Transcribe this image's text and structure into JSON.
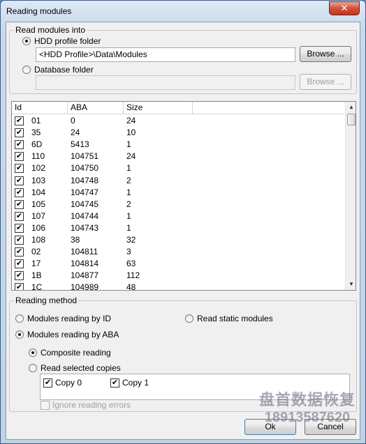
{
  "window": {
    "title": "Reading modules",
    "close_glyph": "✕"
  },
  "read_into": {
    "group_title": "Read modules into",
    "hdd_radio_label": "HDD profile folder",
    "hdd_path": "<HDD Profile>\\Data\\Modules",
    "hdd_browse": "Browse ...",
    "db_radio_label": "Database folder",
    "db_path": "",
    "db_browse": "Browse ..."
  },
  "modules_table": {
    "columns": [
      "Id",
      "ABA",
      "Size"
    ],
    "rows": [
      {
        "checked": true,
        "id": "01",
        "aba": "0",
        "size": "24"
      },
      {
        "checked": true,
        "id": "35",
        "aba": "24",
        "size": "10"
      },
      {
        "checked": true,
        "id": "6D",
        "aba": "5413",
        "size": "1"
      },
      {
        "checked": true,
        "id": "110",
        "aba": "104751",
        "size": "24"
      },
      {
        "checked": true,
        "id": "102",
        "aba": "104750",
        "size": "1"
      },
      {
        "checked": true,
        "id": "103",
        "aba": "104748",
        "size": "2"
      },
      {
        "checked": true,
        "id": "104",
        "aba": "104747",
        "size": "1"
      },
      {
        "checked": true,
        "id": "105",
        "aba": "104745",
        "size": "2"
      },
      {
        "checked": true,
        "id": "107",
        "aba": "104744",
        "size": "1"
      },
      {
        "checked": true,
        "id": "106",
        "aba": "104743",
        "size": "1"
      },
      {
        "checked": true,
        "id": "108",
        "aba": "38",
        "size": "32"
      },
      {
        "checked": true,
        "id": "02",
        "aba": "104811",
        "size": "3"
      },
      {
        "checked": true,
        "id": "17",
        "aba": "104814",
        "size": "63"
      },
      {
        "checked": true,
        "id": "1B",
        "aba": "104877",
        "size": "112"
      },
      {
        "checked": true,
        "id": "1C",
        "aba": "104989",
        "size": "48"
      }
    ]
  },
  "reading_method": {
    "group_title": "Reading method",
    "by_id_label": "Modules reading by ID",
    "static_label": "Read static modules",
    "by_aba_label": "Modules reading by ABA",
    "composite_label": "Composite reading",
    "selected_copies_label": "Read selected copies",
    "copy0_label": "Copy 0",
    "copy1_label": "Copy 1",
    "ignore_errors_label": "Ignore reading errors",
    "selected": "by_aba",
    "sub_selected": "composite"
  },
  "footer": {
    "ok_label": "Ok",
    "cancel_label": "Cancel"
  },
  "watermark": {
    "line1": "盘首数据恢复",
    "line2": "18913587620"
  },
  "icons": {
    "check": "✔",
    "scroll_up": "▲",
    "scroll_down": "▼"
  }
}
